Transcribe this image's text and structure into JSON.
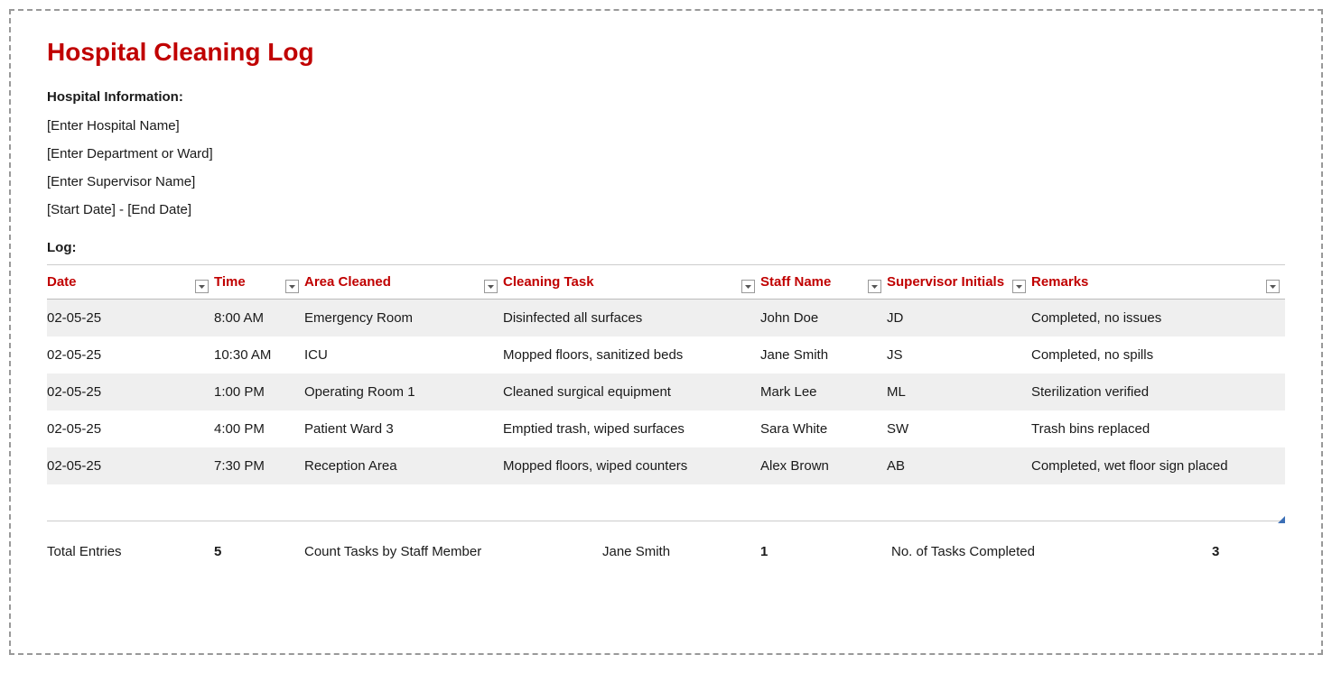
{
  "title": "Hospital Cleaning Log",
  "info": {
    "heading": "Hospital Information:",
    "lines": [
      "[Enter Hospital Name]",
      "[Enter Department or Ward]",
      "[Enter Supervisor Name]",
      "[Start Date] - [End Date]"
    ]
  },
  "log_heading": "Log:",
  "columns": [
    "Date",
    "Time",
    "Area Cleaned",
    "Cleaning Task",
    "Staff Name",
    "Supervisor Initials",
    "Remarks"
  ],
  "rows": [
    {
      "date": "02-05-25",
      "time": "8:00 AM",
      "area": "Emergency Room",
      "task": "Disinfected all surfaces",
      "staff": "John Doe",
      "sup": "JD",
      "remarks": "Completed, no issues"
    },
    {
      "date": "02-05-25",
      "time": "10:30 AM",
      "area": "ICU",
      "task": "Mopped floors, sanitized beds",
      "staff": "Jane Smith",
      "sup": "JS",
      "remarks": "Completed, no spills"
    },
    {
      "date": "02-05-25",
      "time": "1:00 PM",
      "area": "Operating Room 1",
      "task": "Cleaned surgical equipment",
      "staff": "Mark Lee",
      "sup": "ML",
      "remarks": "Sterilization verified"
    },
    {
      "date": "02-05-25",
      "time": "4:00 PM",
      "area": "Patient Ward 3",
      "task": "Emptied trash, wiped surfaces",
      "staff": "Sara White",
      "sup": "SW",
      "remarks": "Trash bins replaced"
    },
    {
      "date": "02-05-25",
      "time": "7:30 PM",
      "area": "Reception Area",
      "task": "Mopped floors, wiped counters",
      "staff": "Alex Brown",
      "sup": "AB",
      "remarks": "Completed, wet floor sign placed"
    }
  ],
  "summary": {
    "total_entries_label": "Total Entries",
    "total_entries_value": "5",
    "count_by_staff_label": "Count Tasks by Staff Member",
    "count_by_staff_name": "Jane Smith",
    "count_by_staff_value": "1",
    "tasks_completed_label": "No. of Tasks Completed",
    "tasks_completed_value": "3"
  }
}
